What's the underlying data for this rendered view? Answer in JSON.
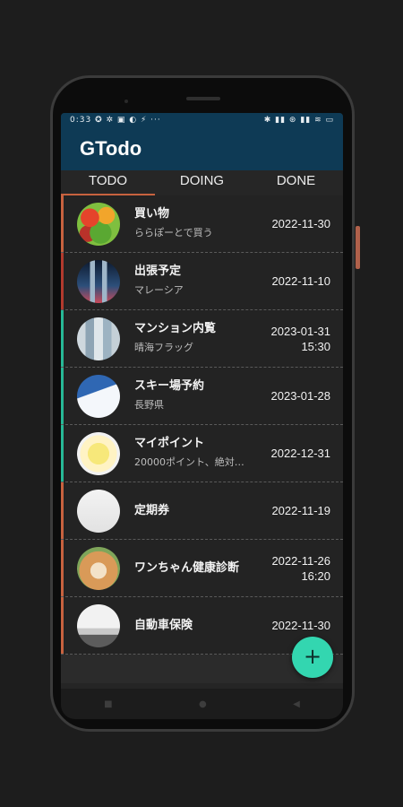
{
  "statusbar": {
    "left": "0:33 ✪ ✲ ▣ ◐ ⚡ ···",
    "right": "✱ ▮▮ ⊛ ▮▮ ≋ ▭"
  },
  "app": {
    "title": "GTodo"
  },
  "tabs": [
    {
      "label": "TODO"
    },
    {
      "label": "DOING"
    },
    {
      "label": "DONE"
    }
  ],
  "items": [
    {
      "title": "買い物",
      "sub": "ららぽーとで買う",
      "date": "2022-11-30",
      "time": "",
      "bar": "#c7623f",
      "avatar": "vegetables"
    },
    {
      "title": "出張予定",
      "sub": "マレーシア",
      "date": "2022-11-10",
      "time": "",
      "bar": "#b23a2d",
      "avatar": "city-towers"
    },
    {
      "title": "マンション内覧",
      "sub": "晴海フラッグ",
      "date": "2023-01-31",
      "time": "15:30",
      "bar": "#27b896",
      "avatar": "apartment"
    },
    {
      "title": "スキー場予約",
      "sub": "長野県",
      "date": "2023-01-28",
      "time": "",
      "bar": "#27b896",
      "avatar": "snow-mountain"
    },
    {
      "title": "マイポイント",
      "sub": "20000ポイント、絶対…",
      "date": "2022-12-31",
      "time": "",
      "bar": "#27b896",
      "avatar": "points-card"
    },
    {
      "title": "定期券",
      "sub": "",
      "date": "2022-11-19",
      "time": "",
      "bar": "#c7623f",
      "avatar": "commuter-pass"
    },
    {
      "title": "ワンちゃん健康診断",
      "sub": "",
      "date": "2022-11-26",
      "time": "16:20",
      "bar": "#c7623f",
      "avatar": "dog"
    },
    {
      "title": "自動車保険",
      "sub": "",
      "date": "2022-11-30",
      "time": "",
      "bar": "#c7623f",
      "avatar": "car"
    }
  ],
  "fab": {
    "label": "+"
  },
  "colors": {
    "appbar": "#0e3a55",
    "accent": "#c7623f",
    "fab": "#33d6b0"
  }
}
